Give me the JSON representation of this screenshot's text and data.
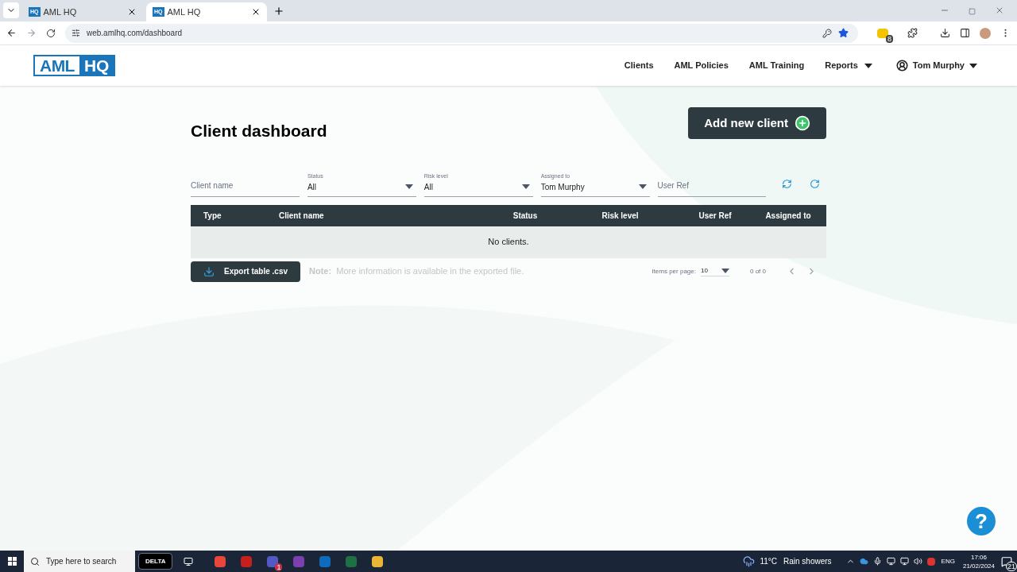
{
  "browser": {
    "tabs": [
      {
        "title": "AML HQ",
        "favicon": "HQ",
        "selected": false
      },
      {
        "title": "AML HQ",
        "favicon": "HQ",
        "selected": true
      }
    ],
    "url": "web.amlhq.com/dashboard",
    "extension_badge": "8"
  },
  "header": {
    "logo": [
      "AML",
      "HQ"
    ],
    "nav": [
      {
        "label": "Clients",
        "dropdown": false
      },
      {
        "label": "AML Policies",
        "dropdown": false
      },
      {
        "label": "AML Training",
        "dropdown": false
      },
      {
        "label": "Reports",
        "dropdown": true
      }
    ],
    "user": "Tom Murphy"
  },
  "page": {
    "title": "Client dashboard",
    "add_button": "Add new client",
    "filters": [
      {
        "kind": "text",
        "placeholder": "Client name"
      },
      {
        "kind": "select",
        "label": "Status",
        "value": "All"
      },
      {
        "kind": "select",
        "label": "Risk level",
        "value": "All"
      },
      {
        "kind": "select",
        "label": "Assigned to",
        "value": "Tom Murphy"
      },
      {
        "kind": "text",
        "placeholder": "User Ref"
      }
    ],
    "table": {
      "columns": [
        "Type",
        "Client name",
        "Status",
        "Risk level",
        "User Ref",
        "Assigned to"
      ],
      "empty": "No clients."
    },
    "export_button": "Export table .csv",
    "note": {
      "label": "Note:",
      "text": "More information is available in the exported file."
    },
    "pagination": {
      "label": "Items per page:",
      "value": "10",
      "range": "0 of 0"
    },
    "help": "?"
  },
  "taskbar": {
    "search": "Type here to search",
    "pinned_logo": "DELTA",
    "teams_badge": "1",
    "weather": {
      "temp": "11°C",
      "condition": "Rain showers"
    },
    "language": "ENG",
    "time": "17:06",
    "date": "21/02/2024",
    "notifications": "21"
  }
}
